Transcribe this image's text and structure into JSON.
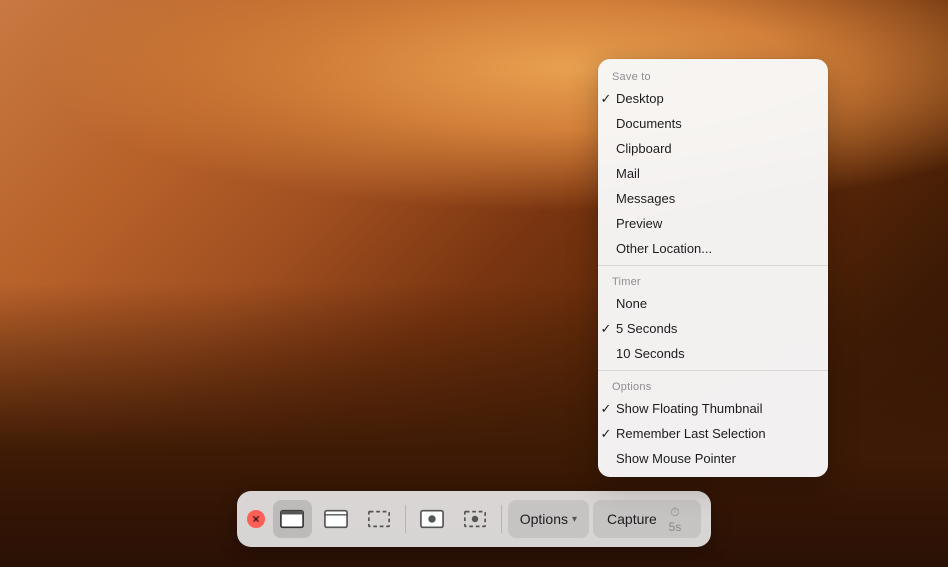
{
  "wallpaper": {
    "alt": "macOS Mojave desert wallpaper"
  },
  "dropdown": {
    "sections": [
      {
        "header": "Save to",
        "items": [
          {
            "label": "Desktop",
            "checked": true
          },
          {
            "label": "Documents",
            "checked": false
          },
          {
            "label": "Clipboard",
            "checked": false
          },
          {
            "label": "Mail",
            "checked": false
          },
          {
            "label": "Messages",
            "checked": false
          },
          {
            "label": "Preview",
            "checked": false
          },
          {
            "label": "Other Location...",
            "checked": false
          }
        ]
      },
      {
        "header": "Timer",
        "items": [
          {
            "label": "None",
            "checked": false
          },
          {
            "label": "5 Seconds",
            "checked": true
          },
          {
            "label": "10 Seconds",
            "checked": false
          }
        ]
      },
      {
        "header": "Options",
        "items": [
          {
            "label": "Show Floating Thumbnail",
            "checked": true
          },
          {
            "label": "Remember Last Selection",
            "checked": true
          },
          {
            "label": "Show Mouse Pointer",
            "checked": false
          }
        ]
      }
    ]
  },
  "toolbar": {
    "buttons": [
      {
        "name": "capture-entire-screen",
        "tooltip": "Capture Entire Screen"
      },
      {
        "name": "capture-selected-window",
        "tooltip": "Capture Selected Window"
      },
      {
        "name": "capture-selected-portion",
        "tooltip": "Capture Selected Portion"
      },
      {
        "name": "record-entire-screen",
        "tooltip": "Record Entire Screen"
      },
      {
        "name": "record-selected-portion",
        "tooltip": "Record Selected Portion"
      }
    ],
    "options_label": "Options",
    "options_chevron": "▾",
    "capture_label": "Capture",
    "capture_timer": "⏱ 5s"
  }
}
